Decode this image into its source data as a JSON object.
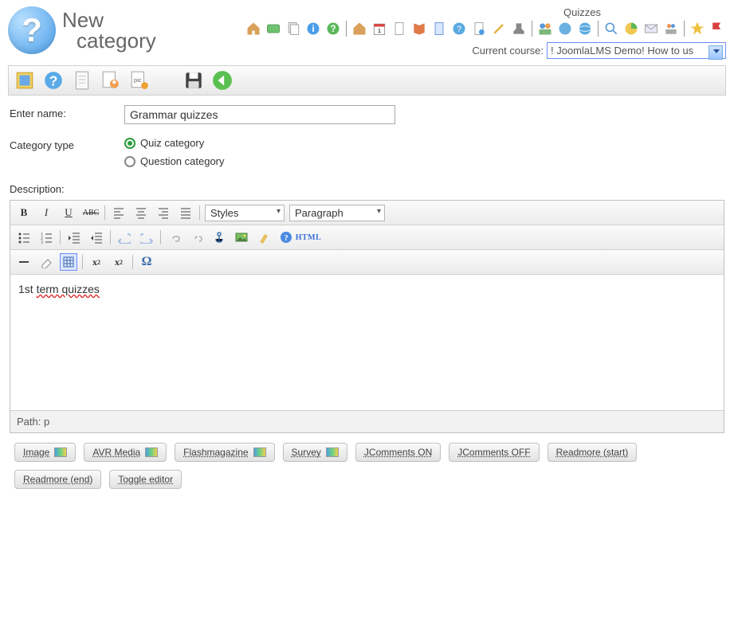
{
  "header": {
    "logo_title_line1": "New",
    "logo_title_line2": "category",
    "section_label": "Quizzes",
    "course_label": "Current course:",
    "course_selected": "! JoomlaLMS Demo! How to us"
  },
  "form": {
    "name_label": "Enter name:",
    "name_value": "Grammar quizzes",
    "type_label": "Category type",
    "type_options": {
      "quiz": "Quiz category",
      "question": "Question category"
    },
    "description_label": "Description:"
  },
  "editor": {
    "styles_label": "Styles",
    "format_label": "Paragraph",
    "html_label": "HTML",
    "content_plain": "1st ",
    "content_err": "term quizzes",
    "path_label": "Path: p"
  },
  "buttons": {
    "image": "Image",
    "avr": "AVR Media",
    "flash": "Flashmagazine",
    "survey": "Survey",
    "jc_on": "JComments ON",
    "jc_off": "JComments OFF",
    "rm_start": "Readmore (start)",
    "rm_end": "Readmore (end)",
    "toggle": "Toggle editor"
  }
}
